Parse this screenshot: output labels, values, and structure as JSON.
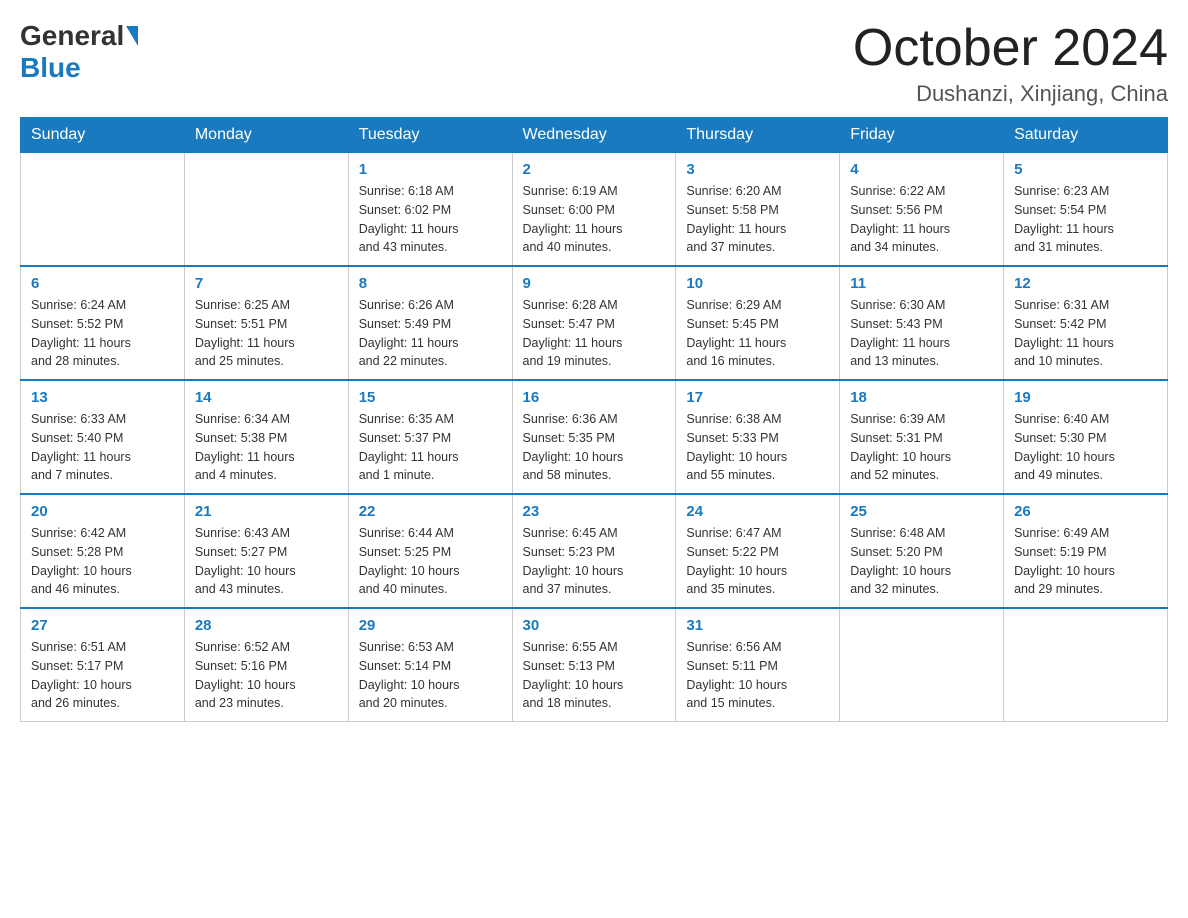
{
  "header": {
    "logo_general": "General",
    "logo_blue": "Blue",
    "month_title": "October 2024",
    "location": "Dushanzi, Xinjiang, China"
  },
  "days_of_week": [
    "Sunday",
    "Monday",
    "Tuesday",
    "Wednesday",
    "Thursday",
    "Friday",
    "Saturday"
  ],
  "weeks": [
    [
      {
        "day": "",
        "info": ""
      },
      {
        "day": "",
        "info": ""
      },
      {
        "day": "1",
        "info": "Sunrise: 6:18 AM\nSunset: 6:02 PM\nDaylight: 11 hours\nand 43 minutes."
      },
      {
        "day": "2",
        "info": "Sunrise: 6:19 AM\nSunset: 6:00 PM\nDaylight: 11 hours\nand 40 minutes."
      },
      {
        "day": "3",
        "info": "Sunrise: 6:20 AM\nSunset: 5:58 PM\nDaylight: 11 hours\nand 37 minutes."
      },
      {
        "day": "4",
        "info": "Sunrise: 6:22 AM\nSunset: 5:56 PM\nDaylight: 11 hours\nand 34 minutes."
      },
      {
        "day": "5",
        "info": "Sunrise: 6:23 AM\nSunset: 5:54 PM\nDaylight: 11 hours\nand 31 minutes."
      }
    ],
    [
      {
        "day": "6",
        "info": "Sunrise: 6:24 AM\nSunset: 5:52 PM\nDaylight: 11 hours\nand 28 minutes."
      },
      {
        "day": "7",
        "info": "Sunrise: 6:25 AM\nSunset: 5:51 PM\nDaylight: 11 hours\nand 25 minutes."
      },
      {
        "day": "8",
        "info": "Sunrise: 6:26 AM\nSunset: 5:49 PM\nDaylight: 11 hours\nand 22 minutes."
      },
      {
        "day": "9",
        "info": "Sunrise: 6:28 AM\nSunset: 5:47 PM\nDaylight: 11 hours\nand 19 minutes."
      },
      {
        "day": "10",
        "info": "Sunrise: 6:29 AM\nSunset: 5:45 PM\nDaylight: 11 hours\nand 16 minutes."
      },
      {
        "day": "11",
        "info": "Sunrise: 6:30 AM\nSunset: 5:43 PM\nDaylight: 11 hours\nand 13 minutes."
      },
      {
        "day": "12",
        "info": "Sunrise: 6:31 AM\nSunset: 5:42 PM\nDaylight: 11 hours\nand 10 minutes."
      }
    ],
    [
      {
        "day": "13",
        "info": "Sunrise: 6:33 AM\nSunset: 5:40 PM\nDaylight: 11 hours\nand 7 minutes."
      },
      {
        "day": "14",
        "info": "Sunrise: 6:34 AM\nSunset: 5:38 PM\nDaylight: 11 hours\nand 4 minutes."
      },
      {
        "day": "15",
        "info": "Sunrise: 6:35 AM\nSunset: 5:37 PM\nDaylight: 11 hours\nand 1 minute."
      },
      {
        "day": "16",
        "info": "Sunrise: 6:36 AM\nSunset: 5:35 PM\nDaylight: 10 hours\nand 58 minutes."
      },
      {
        "day": "17",
        "info": "Sunrise: 6:38 AM\nSunset: 5:33 PM\nDaylight: 10 hours\nand 55 minutes."
      },
      {
        "day": "18",
        "info": "Sunrise: 6:39 AM\nSunset: 5:31 PM\nDaylight: 10 hours\nand 52 minutes."
      },
      {
        "day": "19",
        "info": "Sunrise: 6:40 AM\nSunset: 5:30 PM\nDaylight: 10 hours\nand 49 minutes."
      }
    ],
    [
      {
        "day": "20",
        "info": "Sunrise: 6:42 AM\nSunset: 5:28 PM\nDaylight: 10 hours\nand 46 minutes."
      },
      {
        "day": "21",
        "info": "Sunrise: 6:43 AM\nSunset: 5:27 PM\nDaylight: 10 hours\nand 43 minutes."
      },
      {
        "day": "22",
        "info": "Sunrise: 6:44 AM\nSunset: 5:25 PM\nDaylight: 10 hours\nand 40 minutes."
      },
      {
        "day": "23",
        "info": "Sunrise: 6:45 AM\nSunset: 5:23 PM\nDaylight: 10 hours\nand 37 minutes."
      },
      {
        "day": "24",
        "info": "Sunrise: 6:47 AM\nSunset: 5:22 PM\nDaylight: 10 hours\nand 35 minutes."
      },
      {
        "day": "25",
        "info": "Sunrise: 6:48 AM\nSunset: 5:20 PM\nDaylight: 10 hours\nand 32 minutes."
      },
      {
        "day": "26",
        "info": "Sunrise: 6:49 AM\nSunset: 5:19 PM\nDaylight: 10 hours\nand 29 minutes."
      }
    ],
    [
      {
        "day": "27",
        "info": "Sunrise: 6:51 AM\nSunset: 5:17 PM\nDaylight: 10 hours\nand 26 minutes."
      },
      {
        "day": "28",
        "info": "Sunrise: 6:52 AM\nSunset: 5:16 PM\nDaylight: 10 hours\nand 23 minutes."
      },
      {
        "day": "29",
        "info": "Sunrise: 6:53 AM\nSunset: 5:14 PM\nDaylight: 10 hours\nand 20 minutes."
      },
      {
        "day": "30",
        "info": "Sunrise: 6:55 AM\nSunset: 5:13 PM\nDaylight: 10 hours\nand 18 minutes."
      },
      {
        "day": "31",
        "info": "Sunrise: 6:56 AM\nSunset: 5:11 PM\nDaylight: 10 hours\nand 15 minutes."
      },
      {
        "day": "",
        "info": ""
      },
      {
        "day": "",
        "info": ""
      }
    ]
  ]
}
